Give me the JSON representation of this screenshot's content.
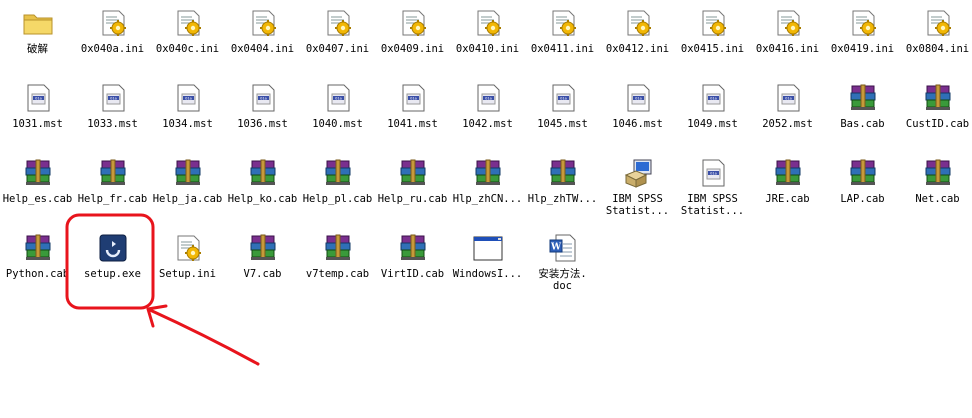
{
  "files": [
    {
      "label": "破解",
      "icon": "folder-icon"
    },
    {
      "label": "0x040a.ini",
      "icon": "ini-file-icon"
    },
    {
      "label": "0x040c.ini",
      "icon": "ini-file-icon"
    },
    {
      "label": "0x0404.ini",
      "icon": "ini-file-icon"
    },
    {
      "label": "0x0407.ini",
      "icon": "ini-file-icon"
    },
    {
      "label": "0x0409.ini",
      "icon": "ini-file-icon"
    },
    {
      "label": "0x0410.ini",
      "icon": "ini-file-icon"
    },
    {
      "label": "0x0411.ini",
      "icon": "ini-file-icon"
    },
    {
      "label": "0x0412.ini",
      "icon": "ini-file-icon"
    },
    {
      "label": "0x0415.ini",
      "icon": "ini-file-icon"
    },
    {
      "label": "0x0416.ini",
      "icon": "ini-file-icon"
    },
    {
      "label": "0x0419.ini",
      "icon": "ini-file-icon"
    },
    {
      "label": "0x0804.ini",
      "icon": "ini-file-icon"
    },
    {
      "label": "1031.mst",
      "icon": "mst-file-icon"
    },
    {
      "label": "1033.mst",
      "icon": "mst-file-icon"
    },
    {
      "label": "1034.mst",
      "icon": "mst-file-icon"
    },
    {
      "label": "1036.mst",
      "icon": "mst-file-icon"
    },
    {
      "label": "1040.mst",
      "icon": "mst-file-icon"
    },
    {
      "label": "1041.mst",
      "icon": "mst-file-icon"
    },
    {
      "label": "1042.mst",
      "icon": "mst-file-icon"
    },
    {
      "label": "1045.mst",
      "icon": "mst-file-icon"
    },
    {
      "label": "1046.mst",
      "icon": "mst-file-icon"
    },
    {
      "label": "1049.mst",
      "icon": "mst-file-icon"
    },
    {
      "label": "2052.mst",
      "icon": "mst-file-icon"
    },
    {
      "label": "Bas.cab",
      "icon": "cab-archive-icon"
    },
    {
      "label": "CustID.cab",
      "icon": "cab-archive-icon"
    },
    {
      "label": "Help_es.cab",
      "icon": "cab-archive-icon"
    },
    {
      "label": "Help_fr.cab",
      "icon": "cab-archive-icon"
    },
    {
      "label": "Help_ja.cab",
      "icon": "cab-archive-icon"
    },
    {
      "label": "Help_ko.cab",
      "icon": "cab-archive-icon"
    },
    {
      "label": "Help_pl.cab",
      "icon": "cab-archive-icon"
    },
    {
      "label": "Help_ru.cab",
      "icon": "cab-archive-icon"
    },
    {
      "label": "Hlp_zhCN...",
      "icon": "cab-archive-icon"
    },
    {
      "label": "Hlp_zhTW...",
      "icon": "cab-archive-icon"
    },
    {
      "label": "IBM SPSS\nStatist...",
      "icon": "installer-package-icon"
    },
    {
      "label": "IBM SPSS\nStatist...",
      "icon": "mst-file-icon"
    },
    {
      "label": "JRE.cab",
      "icon": "cab-archive-icon"
    },
    {
      "label": "LAP.cab",
      "icon": "cab-archive-icon"
    },
    {
      "label": "Net.cab",
      "icon": "cab-archive-icon"
    },
    {
      "label": "Python.cab",
      "icon": "cab-archive-icon"
    },
    {
      "label": "setup.exe",
      "icon": "setup-exe-icon"
    },
    {
      "label": "Setup.ini",
      "icon": "ini-file-icon"
    },
    {
      "label": "V7.cab",
      "icon": "cab-archive-icon"
    },
    {
      "label": "v7temp.cab",
      "icon": "cab-archive-icon"
    },
    {
      "label": "VirtID.cab",
      "icon": "cab-archive-icon"
    },
    {
      "label": "WindowsI...",
      "icon": "window-app-icon"
    },
    {
      "label": "安装方法.\ndoc",
      "icon": "word-doc-icon"
    }
  ],
  "annotation": {
    "color": "#e8141c"
  }
}
